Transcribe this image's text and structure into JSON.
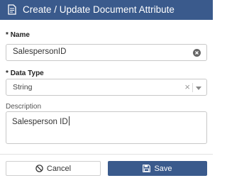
{
  "dialog": {
    "title": "Create / Update Document Attribute",
    "title_icon": "document-edit-icon",
    "header_color": "#3a5a8c"
  },
  "form": {
    "name": {
      "required_marker": "*",
      "label": "Name",
      "value": "SalespersonID",
      "clear_icon": "clear-circle-icon"
    },
    "data_type": {
      "required_marker": "*",
      "label": "Data Type",
      "selected": "String",
      "clear_icon": "close-icon",
      "dropdown_icon": "chevron-down-icon"
    },
    "description": {
      "label": "Description",
      "value": "Salesperson ID"
    }
  },
  "footer": {
    "cancel_label": "Cancel",
    "cancel_icon": "ban-icon",
    "save_label": "Save",
    "save_icon": "floppy-disk-icon",
    "save_color": "#3a5a8c"
  }
}
